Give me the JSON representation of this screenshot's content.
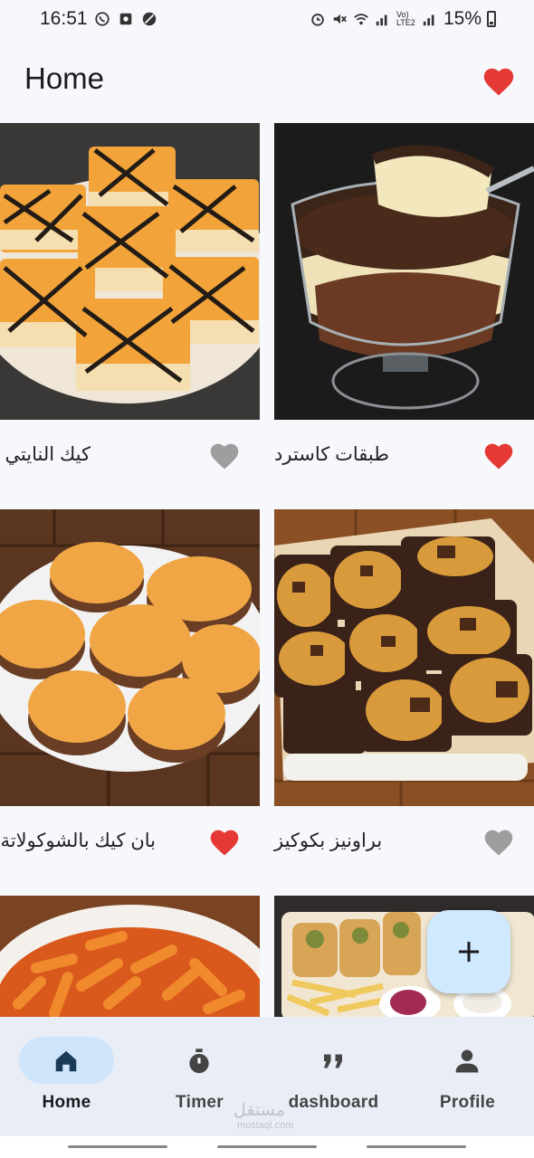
{
  "status_bar": {
    "time": "16:51",
    "battery": "15%",
    "network_label": "Vo) LTE2"
  },
  "app_bar": {
    "title": "Home",
    "favorites_icon": "heart-icon",
    "favorites_color": "#e53935"
  },
  "recipes": [
    {
      "name": "كيك النايتي",
      "favorite": false
    },
    {
      "name": "طبقات كاسترد",
      "favorite": true
    },
    {
      "name": "بان كيك بالشوكولاتة",
      "favorite": true
    },
    {
      "name": "براونيز بكوكيز",
      "favorite": false
    }
  ],
  "fab": {
    "icon": "plus-icon"
  },
  "nav": {
    "items": [
      {
        "label": "Home",
        "icon": "home-icon",
        "active": true
      },
      {
        "label": "Timer",
        "icon": "timer-icon",
        "active": false
      },
      {
        "label": "dashboard",
        "icon": "quote-icon",
        "active": false
      },
      {
        "label": "Profile",
        "icon": "person-icon",
        "active": false
      }
    ]
  },
  "watermark": {
    "text": "مستقل",
    "sub": "mostaql.com"
  },
  "colors": {
    "favorite": "#e53935",
    "not_favorite": "#9e9e9e",
    "fab": "#cfe9ff",
    "nav_background": "#e9eef6",
    "nav_active_pill": "#cfe5fb"
  }
}
